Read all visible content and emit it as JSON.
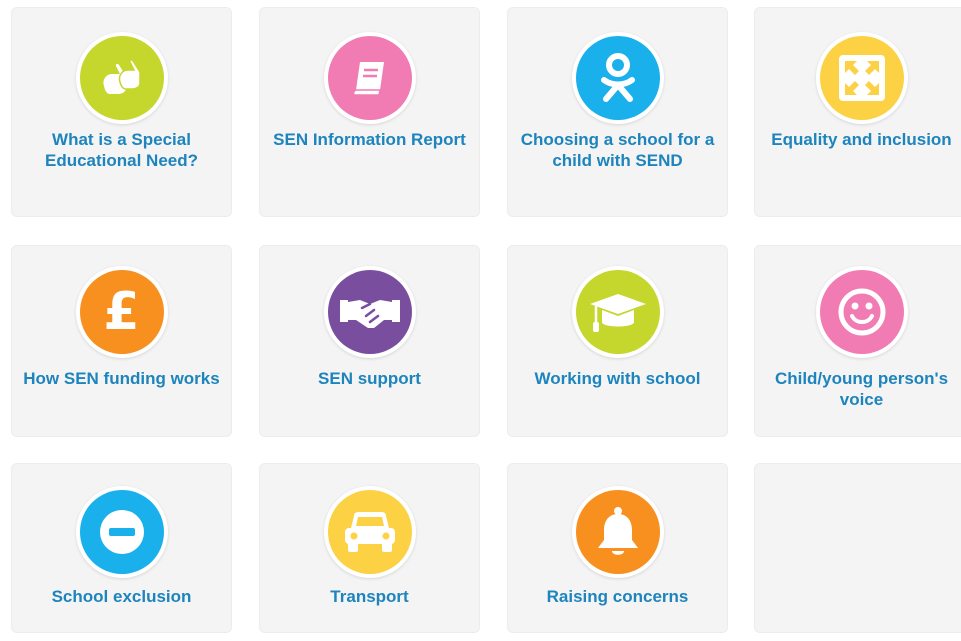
{
  "cards": [
    {
      "title": "What is a Special Educational Need?",
      "icon": "sign-language-icon",
      "color": "#c5d62d"
    },
    {
      "title": "SEN Information Report",
      "icon": "book-icon",
      "color": "#f07cb3"
    },
    {
      "title": "Choosing a school for a child with SEND",
      "icon": "person-icon",
      "color": "#1ab0ec"
    },
    {
      "title": "Equality and inclusion",
      "icon": "expand-arrows-icon",
      "color": "#fcd144"
    },
    {
      "title": "How SEN funding works",
      "icon": "pound-icon",
      "icon_text": "£",
      "color": "#f7901e"
    },
    {
      "title": "SEN support",
      "icon": "handshake-icon",
      "color": "#7a4e9e"
    },
    {
      "title": "Working with school",
      "icon": "graduation-cap-icon",
      "color": "#c5d62d"
    },
    {
      "title": "Child/young person's voice",
      "icon": "smiley-icon",
      "color": "#f07cb3"
    },
    {
      "title": "School exclusion",
      "icon": "minus-circle-icon",
      "color": "#1ab0ec"
    },
    {
      "title": "Transport",
      "icon": "car-icon",
      "color": "#fcd144"
    },
    {
      "title": "Raising concerns",
      "icon": "bell-icon",
      "color": "#f7901e"
    }
  ]
}
